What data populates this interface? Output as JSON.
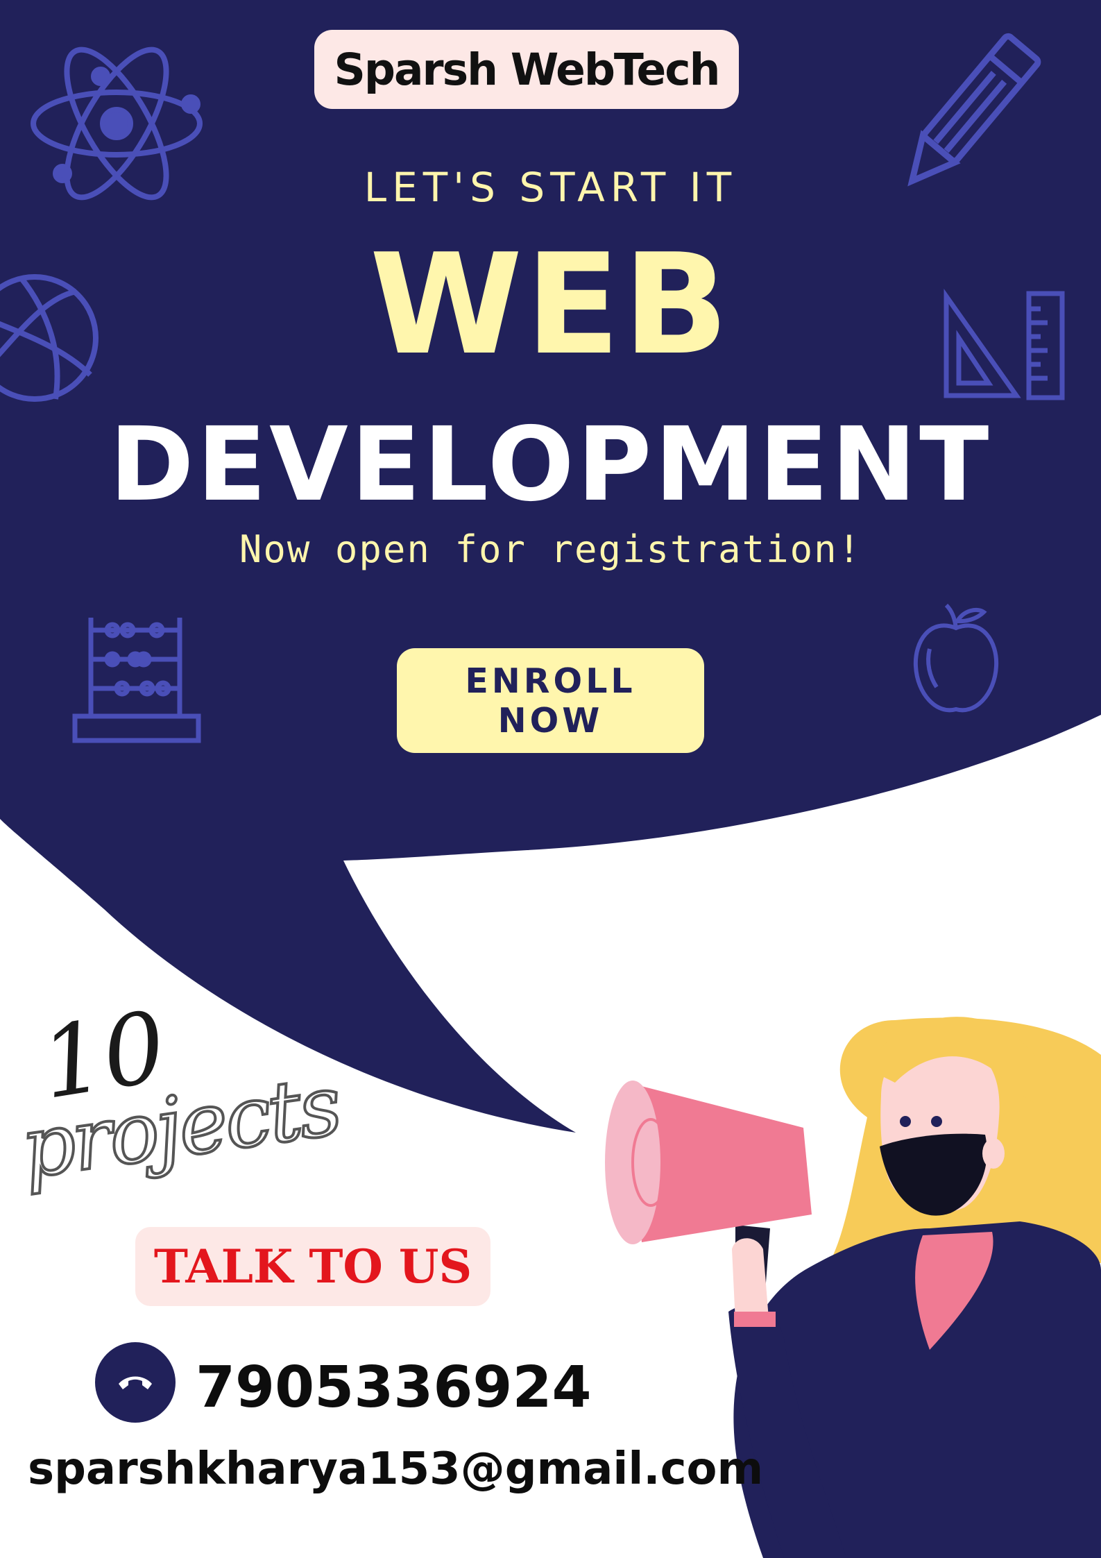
{
  "brand": {
    "name": "Sparsh WebTech"
  },
  "hero": {
    "kicker": "LET'S START IT",
    "title_line1": "WEB",
    "title_line2": "DEVELOPMENT",
    "subtitle": "Now open for registration!"
  },
  "cta": {
    "enroll_label": "ENROLL NOW"
  },
  "projects": {
    "count": "10",
    "label": "projects"
  },
  "contact": {
    "talk_label": "TALK TO US",
    "phone": "7905336924",
    "email": "sparshkharya153@gmail.com"
  },
  "icons": [
    "atom-icon",
    "pencil-icon",
    "basketball-icon",
    "ruler-triangle-icon",
    "abacus-icon",
    "apple-icon",
    "phone-icon",
    "megaphone-icon"
  ],
  "colors": {
    "navy": "#21215a",
    "accent_yellow": "#fff6ad",
    "icon_blue": "#4a4fb8",
    "pink_box": "#fde8e6",
    "talk_red": "#e3161d",
    "hair": "#f7cb58",
    "megaphone_pink": "#f07a93"
  }
}
